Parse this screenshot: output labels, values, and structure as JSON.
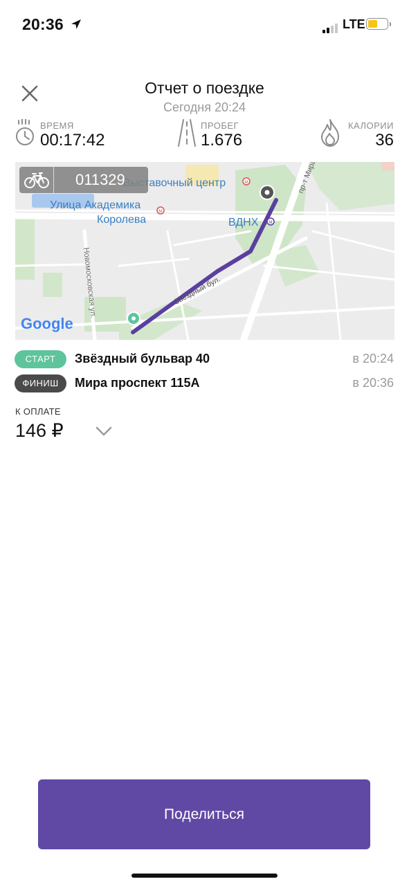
{
  "status_bar": {
    "time": "20:36",
    "network": "LTE",
    "battery_level": 0.5,
    "battery_color": "#f5c518"
  },
  "header": {
    "title": "Отчет о поездке",
    "subtitle": "Сегодня 20:24"
  },
  "stats": {
    "time": {
      "label": "ВРЕМЯ",
      "value": "00:17:42",
      "icon": "stopwatch-icon"
    },
    "distance": {
      "label": "ПРОБЕГ",
      "value": "1.676",
      "icon": "road-icon"
    },
    "calories": {
      "label": "КАЛОРИИ",
      "value": "36",
      "icon": "flame-icon"
    }
  },
  "map": {
    "bike_id": "011329",
    "bike_icon": "bicycle-icon",
    "labels": {
      "exhibition": "Выставочный центр",
      "akademika": "Улица Академика",
      "koroleva": "Королева",
      "vdnh": "ВДНХ",
      "mira": "пр-т Мира",
      "zvezdny": "Звёздный бул.",
      "novomoskovskaya": "Новомосковская ул.",
      "google": "Google"
    },
    "route_color": "#5b3fa0",
    "start_marker_color": "#5ec49b",
    "end_marker_color": "#555555"
  },
  "route": {
    "start": {
      "badge": "СТАРТ",
      "address": "Звёздный бульвар 40",
      "time": "в 20:24",
      "badge_color": "#5ec49b"
    },
    "finish": {
      "badge": "ФИНИШ",
      "address": "Мира проспект 115А",
      "time": "в 20:36",
      "badge_color": "#4a4a4a"
    }
  },
  "payment": {
    "label": "К ОПЛАТЕ",
    "amount": "146 ₽"
  },
  "share_button": {
    "label": "Поделиться",
    "color": "#6049a5"
  }
}
